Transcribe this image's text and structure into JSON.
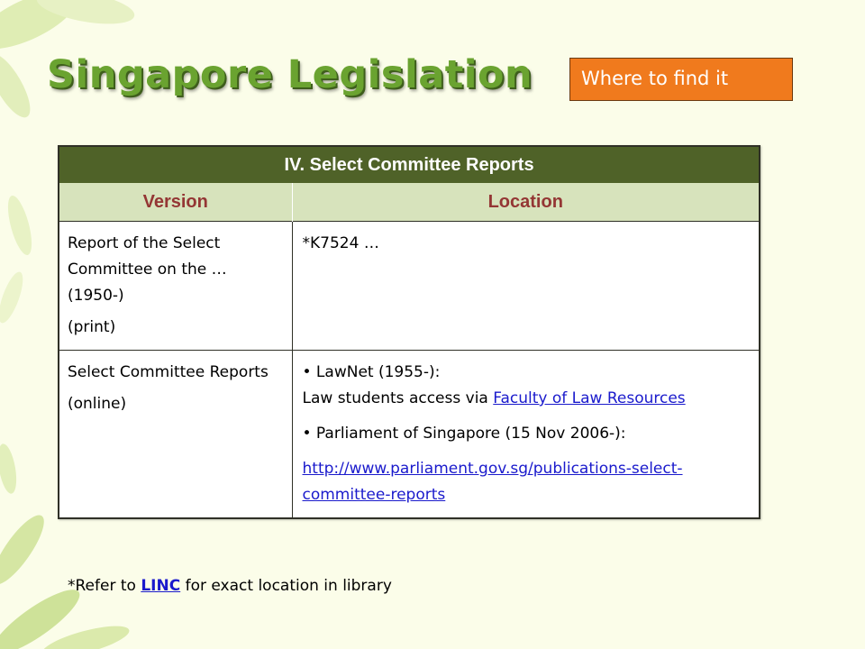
{
  "slide": {
    "title": "Singapore Legislation",
    "where_box": "Where to find it"
  },
  "table": {
    "title": "IV. Select Committee Reports",
    "columns": [
      "Version",
      "Location"
    ],
    "rows": [
      {
        "version_lines": [
          "Report of the Select Committee on the … (1950-)",
          "(print)"
        ],
        "location": {
          "text": "*K7524 …"
        }
      },
      {
        "version_lines": [
          "Select Committee Reports",
          "(online)"
        ],
        "location": {
          "item1": "• LawNet (1955-):",
          "item1_note": "Law students access via ",
          "item1_link": "Faculty of Law Resources",
          "item2": "• Parliament of Singapore (15 Nov 2006-):",
          "item2_link": "http://www.parliament.gov.sg/publications-select-committee-reports"
        }
      }
    ]
  },
  "footnote": {
    "prefix": "*Refer to ",
    "link": "LINC",
    "suffix": " for exact location in library"
  },
  "colors": {
    "background": "#fbfde9",
    "title_green": "#6aa330",
    "header_dark_green": "#4f6228",
    "header_light_green": "#d7e3bc",
    "column_header_text": "#943634",
    "orange_box": "#f07a1d",
    "link_blue": "#1a1acc"
  },
  "decorations": [
    "green-leaves-top-left",
    "green-leaves-bottom-left"
  ]
}
